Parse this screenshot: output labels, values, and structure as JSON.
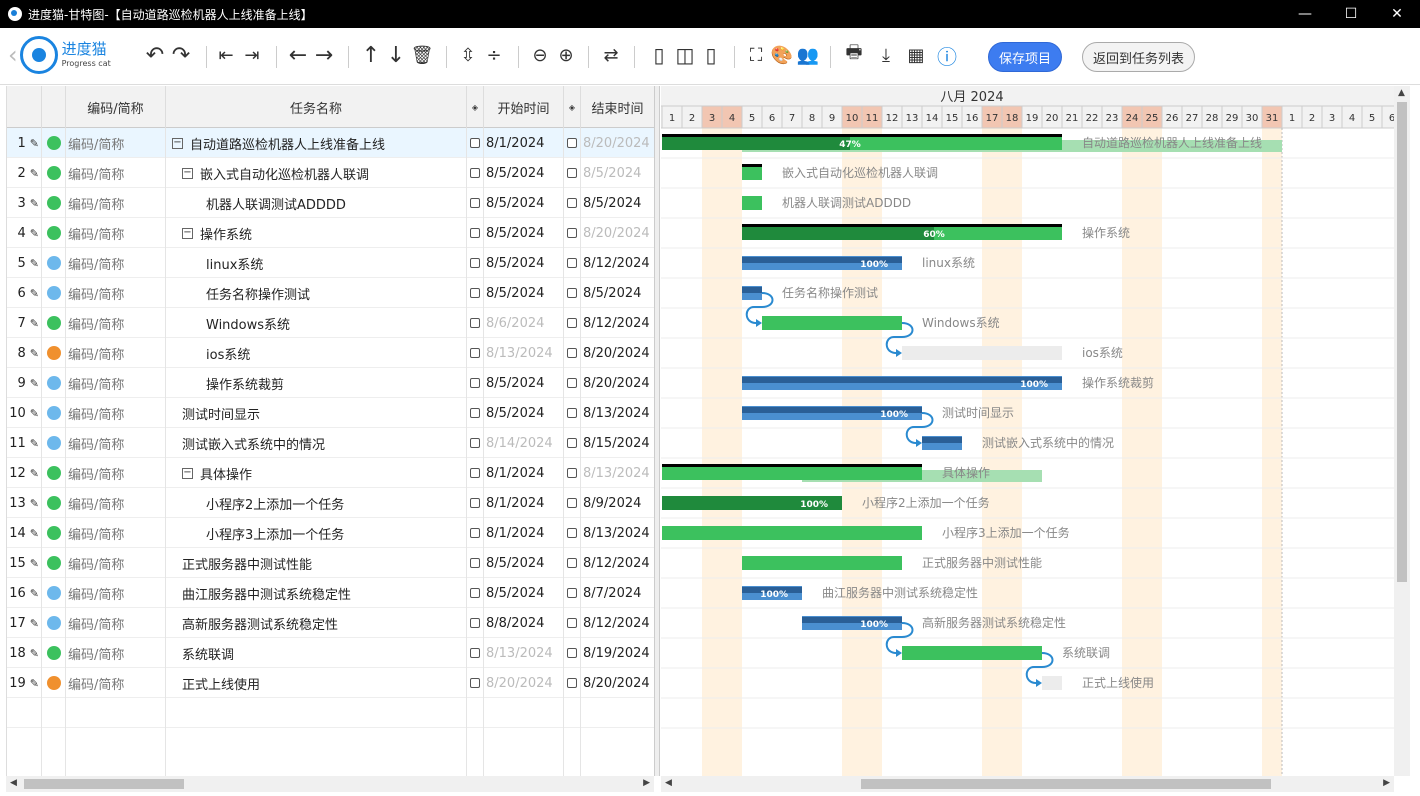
{
  "window": {
    "title": "进度猫-甘特图-【自动道路巡检机器人上线准备上线】",
    "minimize": "—",
    "maximize": "☐",
    "close": "✕"
  },
  "logo": {
    "cn": "进度猫",
    "en": "Progress cat"
  },
  "toolbar": {
    "save_label": "保存项目",
    "back_label": "返回到任务列表"
  },
  "grid": {
    "headers": {
      "code": "编码/简称",
      "name": "任务名称",
      "start": "开始时间",
      "end": "结束时间"
    },
    "rows": [
      {
        "num": "1",
        "dot": "#3cc15e",
        "code": "编码/简称",
        "name": "自动道路巡检机器人上线准备上线",
        "indent": 0,
        "toggle": "−",
        "start": "8/1/2024",
        "start_dim": false,
        "end": "8/20/2024",
        "end_dim": true,
        "sel": true
      },
      {
        "num": "2",
        "dot": "#3cc15e",
        "code": "编码/简称",
        "name": "嵌入式自动化巡检机器人联调",
        "indent": 1,
        "toggle": "−",
        "start": "8/5/2024",
        "start_dim": false,
        "end": "8/5/2024",
        "end_dim": true
      },
      {
        "num": "3",
        "dot": "#3cc15e",
        "code": "编码/简称",
        "name": "机器人联调测试ADDDD",
        "indent": 2,
        "toggle": "",
        "start": "8/5/2024",
        "start_dim": false,
        "end": "8/5/2024",
        "end_dim": false
      },
      {
        "num": "4",
        "dot": "#3cc15e",
        "code": "编码/简称",
        "name": "操作系统",
        "indent": 1,
        "toggle": "−",
        "start": "8/5/2024",
        "start_dim": false,
        "end": "8/20/2024",
        "end_dim": true
      },
      {
        "num": "5",
        "dot": "#6db8ec",
        "code": "编码/简称",
        "name": "linux系统",
        "indent": 2,
        "toggle": "",
        "start": "8/5/2024",
        "start_dim": false,
        "end": "8/12/2024",
        "end_dim": false
      },
      {
        "num": "6",
        "dot": "#6db8ec",
        "code": "编码/简称",
        "name": "任务名称操作测试",
        "indent": 2,
        "toggle": "",
        "start": "8/5/2024",
        "start_dim": false,
        "end": "8/5/2024",
        "end_dim": false
      },
      {
        "num": "7",
        "dot": "#3cc15e",
        "code": "编码/简称",
        "name": "Windows系统",
        "indent": 2,
        "toggle": "",
        "start": "8/6/2024",
        "start_dim": true,
        "end": "8/12/2024",
        "end_dim": false
      },
      {
        "num": "8",
        "dot": "#f0902e",
        "code": "编码/简称",
        "name": "ios系统",
        "indent": 2,
        "toggle": "",
        "start": "8/13/2024",
        "start_dim": true,
        "end": "8/20/2024",
        "end_dim": false
      },
      {
        "num": "9",
        "dot": "#6db8ec",
        "code": "编码/简称",
        "name": "操作系统裁剪",
        "indent": 2,
        "toggle": "",
        "start": "8/5/2024",
        "start_dim": false,
        "end": "8/20/2024",
        "end_dim": false
      },
      {
        "num": "10",
        "dot": "#6db8ec",
        "code": "编码/简称",
        "name": "测试时间显示",
        "indent": 1,
        "toggle": "",
        "start": "8/5/2024",
        "start_dim": false,
        "end": "8/13/2024",
        "end_dim": false
      },
      {
        "num": "11",
        "dot": "#6db8ec",
        "code": "编码/简称",
        "name": "测试嵌入式系统中的情况",
        "indent": 1,
        "toggle": "",
        "start": "8/14/2024",
        "start_dim": true,
        "end": "8/15/2024",
        "end_dim": false
      },
      {
        "num": "12",
        "dot": "#3cc15e",
        "code": "编码/简称",
        "name": "具体操作",
        "indent": 1,
        "toggle": "−",
        "start": "8/1/2024",
        "start_dim": false,
        "end": "8/13/2024",
        "end_dim": true
      },
      {
        "num": "13",
        "dot": "#3cc15e",
        "code": "编码/简称",
        "name": "小程序2上添加一个任务",
        "indent": 2,
        "toggle": "",
        "start": "8/1/2024",
        "start_dim": false,
        "end": "8/9/2024",
        "end_dim": false
      },
      {
        "num": "14",
        "dot": "#3cc15e",
        "code": "编码/简称",
        "name": "小程序3上添加一个任务",
        "indent": 2,
        "toggle": "",
        "start": "8/1/2024",
        "start_dim": false,
        "end": "8/13/2024",
        "end_dim": false
      },
      {
        "num": "15",
        "dot": "#3cc15e",
        "code": "编码/简称",
        "name": "正式服务器中测试性能",
        "indent": 1,
        "toggle": "",
        "start": "8/5/2024",
        "start_dim": false,
        "end": "8/12/2024",
        "end_dim": false
      },
      {
        "num": "16",
        "dot": "#6db8ec",
        "code": "编码/简称",
        "name": "曲江服务器中测试系统稳定性",
        "indent": 1,
        "toggle": "",
        "start": "8/5/2024",
        "start_dim": false,
        "end": "8/7/2024",
        "end_dim": false
      },
      {
        "num": "17",
        "dot": "#6db8ec",
        "code": "编码/简称",
        "name": "高新服务器测试系统稳定性",
        "indent": 1,
        "toggle": "",
        "start": "8/8/2024",
        "start_dim": false,
        "end": "8/12/2024",
        "end_dim": false
      },
      {
        "num": "18",
        "dot": "#3cc15e",
        "code": "编码/简称",
        "name": "系统联调",
        "indent": 1,
        "toggle": "",
        "start": "8/13/2024",
        "start_dim": true,
        "end": "8/19/2024",
        "end_dim": false
      },
      {
        "num": "19",
        "dot": "#f0902e",
        "code": "编码/简称",
        "name": "正式上线使用",
        "indent": 1,
        "toggle": "",
        "start": "8/20/2024",
        "start_dim": true,
        "end": "8/20/2024",
        "end_dim": false
      }
    ]
  },
  "gantt": {
    "month": "八月 2024",
    "days": [
      "1",
      "2",
      "3",
      "4",
      "5",
      "6",
      "7",
      "8",
      "9",
      "10",
      "11",
      "12",
      "13",
      "14",
      "15",
      "16",
      "17",
      "18",
      "19",
      "20",
      "21",
      "22",
      "23",
      "24",
      "25",
      "26",
      "27",
      "28",
      "29",
      "30",
      "31",
      "1",
      "2",
      "3",
      "4",
      "5",
      "6"
    ],
    "weekend_idx": [
      2,
      3,
      9,
      10,
      16,
      17,
      23,
      24,
      30
    ],
    "bars": [
      {
        "row": 0,
        "start": 1,
        "end": 21,
        "type": "summary",
        "progress": 47,
        "label": "47%",
        "text": "自动道路巡检机器人上线准备上线",
        "baseline": [
          5,
          32
        ]
      },
      {
        "row": 1,
        "start": 5,
        "end": 6,
        "type": "summary",
        "progress": 0,
        "label": "",
        "text": "嵌入式自动化巡检机器人联调"
      },
      {
        "row": 2,
        "start": 5,
        "end": 6,
        "type": "task",
        "progress": 0,
        "label": "",
        "text": "机器人联调测试ADDDD"
      },
      {
        "row": 3,
        "start": 5,
        "end": 21,
        "type": "summary",
        "progress": 60,
        "label": "60%",
        "text": "操作系统"
      },
      {
        "row": 4,
        "start": 5,
        "end": 13,
        "type": "blue",
        "progress": 100,
        "label": "100%",
        "text": "linux系统"
      },
      {
        "row": 5,
        "start": 5,
        "end": 6,
        "type": "blue",
        "progress": 100,
        "label": "",
        "text": "任务名称操作测试"
      },
      {
        "row": 6,
        "start": 6,
        "end": 13,
        "type": "task",
        "progress": 0,
        "label": "",
        "text": "Windows系统"
      },
      {
        "row": 7,
        "start": 13,
        "end": 21,
        "type": "gray",
        "progress": 0,
        "label": "",
        "text": "ios系统"
      },
      {
        "row": 8,
        "start": 5,
        "end": 21,
        "type": "blue",
        "progress": 100,
        "label": "100%",
        "text": "操作系统裁剪"
      },
      {
        "row": 9,
        "start": 5,
        "end": 14,
        "type": "blue",
        "progress": 100,
        "label": "100%",
        "text": "测试时间显示"
      },
      {
        "row": 10,
        "start": 14,
        "end": 16,
        "type": "blue",
        "progress": 100,
        "label": "",
        "text": "测试嵌入式系统中的情况"
      },
      {
        "row": 11,
        "start": 1,
        "end": 14,
        "type": "summary",
        "progress": 0,
        "label": "",
        "text": "具体操作",
        "baseline": [
          8,
          20
        ]
      },
      {
        "row": 12,
        "start": 1,
        "end": 10,
        "type": "task",
        "progress": 100,
        "label": "100%",
        "text": "小程序2上添加一个任务"
      },
      {
        "row": 13,
        "start": 1,
        "end": 14,
        "type": "task",
        "progress": 0,
        "label": "",
        "text": "小程序3上添加一个任务"
      },
      {
        "row": 14,
        "start": 5,
        "end": 13,
        "type": "task",
        "progress": 0,
        "label": "",
        "text": "正式服务器中测试性能"
      },
      {
        "row": 15,
        "start": 5,
        "end": 8,
        "type": "blue",
        "progress": 100,
        "label": "100%",
        "text": "曲江服务器中测试系统稳定性"
      },
      {
        "row": 16,
        "start": 8,
        "end": 13,
        "type": "blue",
        "progress": 100,
        "label": "100%",
        "text": "高新服务器测试系统稳定性"
      },
      {
        "row": 17,
        "start": 13,
        "end": 20,
        "type": "task",
        "progress": 0,
        "label": "",
        "text": "系统联调"
      },
      {
        "row": 18,
        "start": 20,
        "end": 21,
        "type": "gray",
        "progress": 0,
        "label": "",
        "text": "正式上线使用"
      }
    ],
    "links": [
      [
        5,
        6
      ],
      [
        6,
        7
      ],
      [
        9,
        10
      ],
      [
        16,
        17
      ],
      [
        17,
        18
      ]
    ],
    "colors": {
      "green": "#3cc15e",
      "darkgreen": "#1f8a3c",
      "blue": "#4a8fd0",
      "darkblue": "#2a5f96",
      "gray": "#ececec",
      "weekend": "#fff2e0",
      "weekend_hdr": "#f2c6b2",
      "link": "#2a8ad0"
    }
  }
}
